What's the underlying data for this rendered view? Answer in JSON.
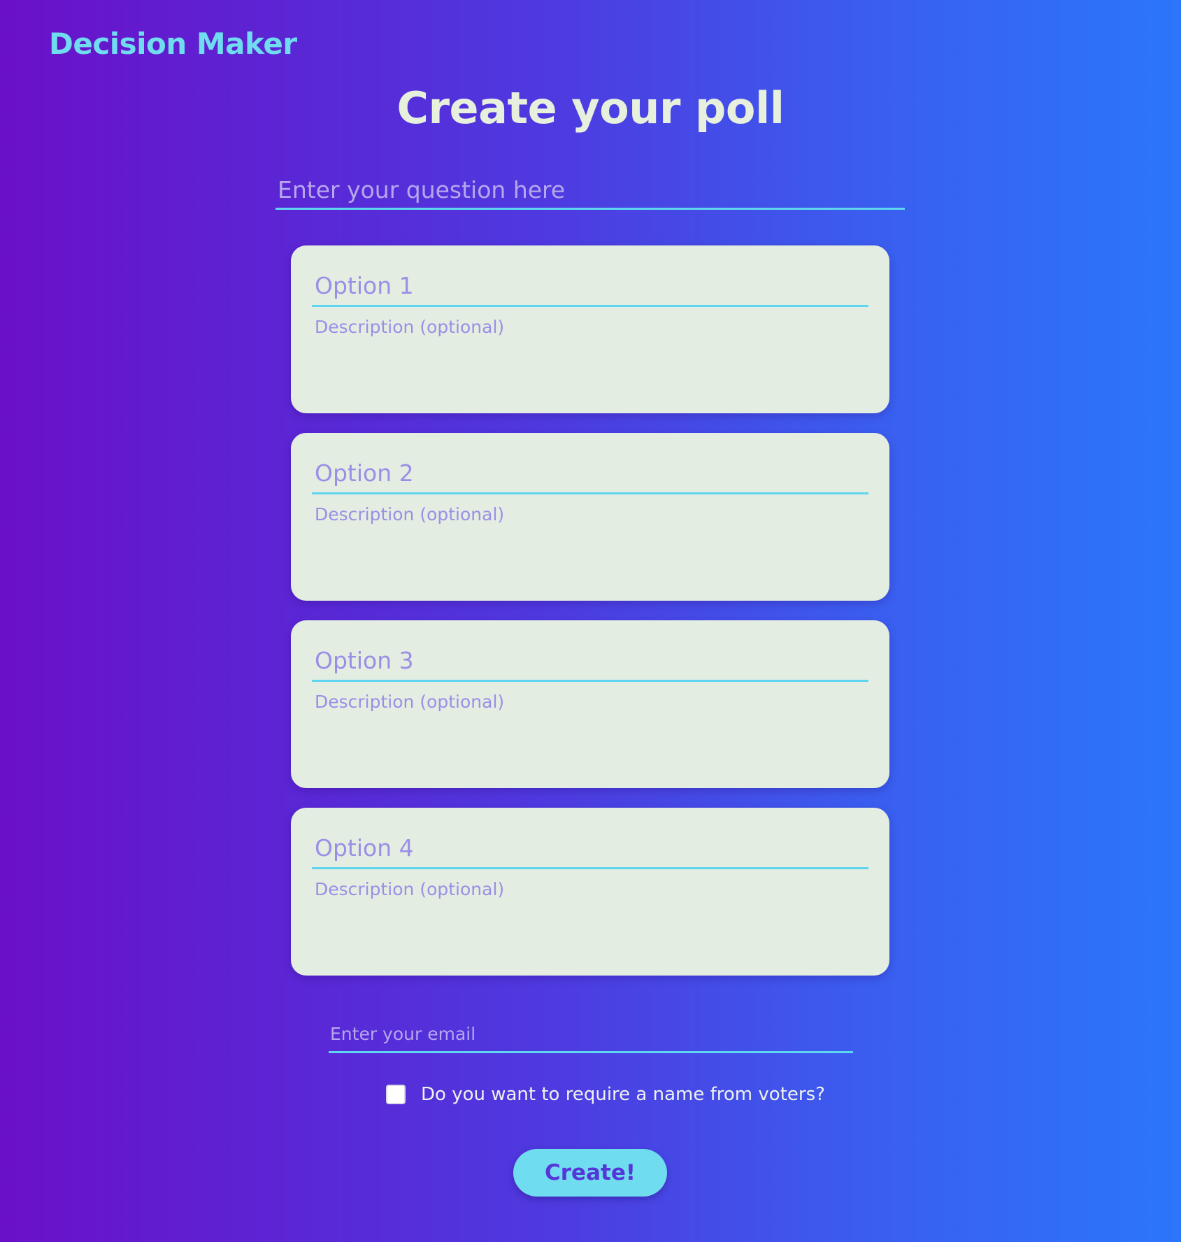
{
  "app": {
    "logo_text": "Decision Maker",
    "page_title": "Create your poll"
  },
  "question": {
    "placeholder": "Enter your question here",
    "value": ""
  },
  "options": [
    {
      "placeholder": "Option 1",
      "description_placeholder": "Description (optional)"
    },
    {
      "placeholder": "Option 2",
      "description_placeholder": "Description (optional)"
    },
    {
      "placeholder": "Option 3",
      "description_placeholder": "Description (optional)"
    },
    {
      "placeholder": "Option 4",
      "description_placeholder": "Description (optional)"
    }
  ],
  "email": {
    "placeholder": "Enter your email",
    "value": ""
  },
  "require_name": {
    "label": "Do you want to require a name from voters?",
    "checked": false
  },
  "submit": {
    "label": "Create!"
  },
  "colors": {
    "background_start": "#6a10c8",
    "background_end": "#2b76fb",
    "accent": "#5fd6f0",
    "card_background": "#e4ede2",
    "button_text": "#5537d8",
    "title_text": "#e7efdd"
  }
}
